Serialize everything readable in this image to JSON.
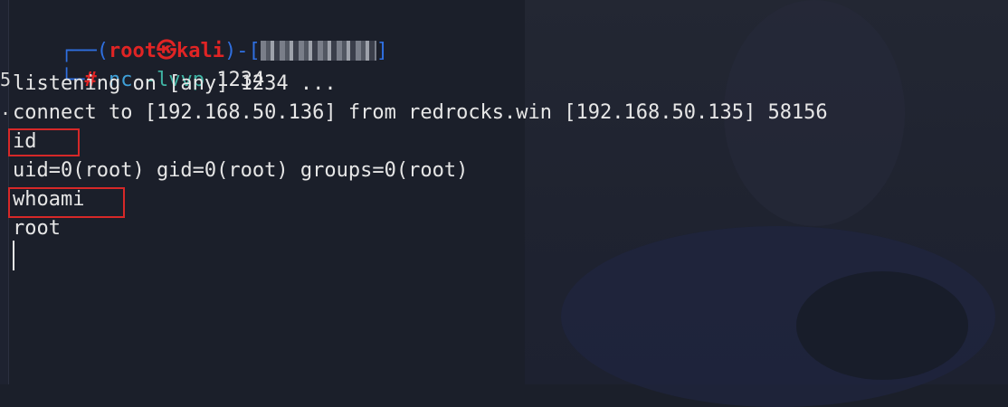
{
  "prompt": {
    "frame_top": "┌──(",
    "user": "root",
    "separator_symbol": "㉿",
    "host": "kali",
    "frame_mid": ")-[",
    "frame_end": "]",
    "frame_bottom": "└─",
    "hash": "#"
  },
  "command": {
    "name": "nc",
    "flags": "-lvvp",
    "arg": "1234"
  },
  "output_lines": [
    "listening on [any] 1234 ...",
    "connect to [192.168.50.136] from redrocks.win [192.168.50.135] 58156",
    "id",
    "uid=0(root) gid=0(root) groups=0(root)",
    "whoami",
    "root"
  ],
  "edge_glyphs": [
    "5",
    "."
  ],
  "colors": {
    "background": "#1b1f2a",
    "prompt_frame": "#2f6fe0",
    "prompt_red": "#e02424",
    "command_blue": "#3fa0d8",
    "highlight_box": "#d62828",
    "text": "#e6e6e6"
  }
}
